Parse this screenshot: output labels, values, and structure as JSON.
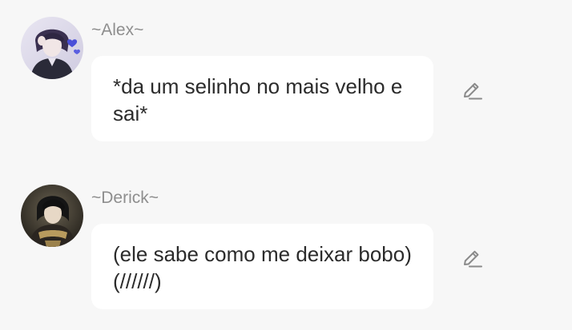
{
  "messages": [
    {
      "username": "~Alex~",
      "text": "*da um selinho no mais velho e sai*",
      "avatar_icon": "avatar-photo-dark-hair",
      "edit_icon": "pencil-icon"
    },
    {
      "username": "~Derick~",
      "text": "(ele sabe como me deixar bobo) (//////)",
      "avatar_icon": "avatar-photo-dark-hair",
      "edit_icon": "pencil-icon"
    }
  ],
  "colors": {
    "background": "#f7f7f7",
    "bubble": "#ffffff",
    "username": "#8e8e8e",
    "text": "#2b2b2b",
    "icon": "#8a8a8a"
  }
}
